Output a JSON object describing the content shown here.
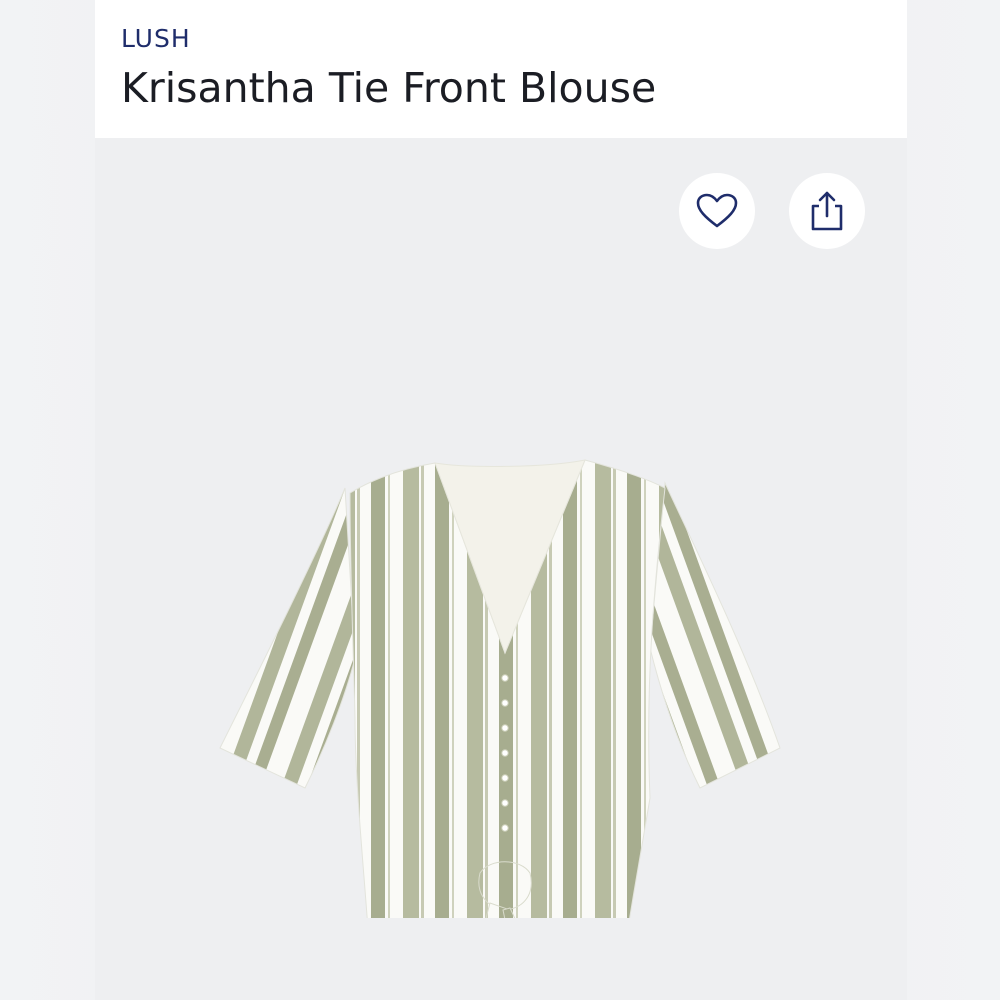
{
  "header": {
    "brand": "LUSH",
    "title": "Krisantha Tie Front Blouse"
  },
  "actions": {
    "favorite_icon": "heart-outline-icon",
    "share_icon": "share-upload-icon"
  },
  "product": {
    "image_subject": "striped-tie-front-blouse",
    "stripe_color": "#a7ad8f",
    "fabric_color": "#fafaf7"
  },
  "colors": {
    "brand_text": "#1f2d6b",
    "title_text": "#1b1d24",
    "icon_navy": "#1f2d6b",
    "background": "#eeeff1"
  }
}
